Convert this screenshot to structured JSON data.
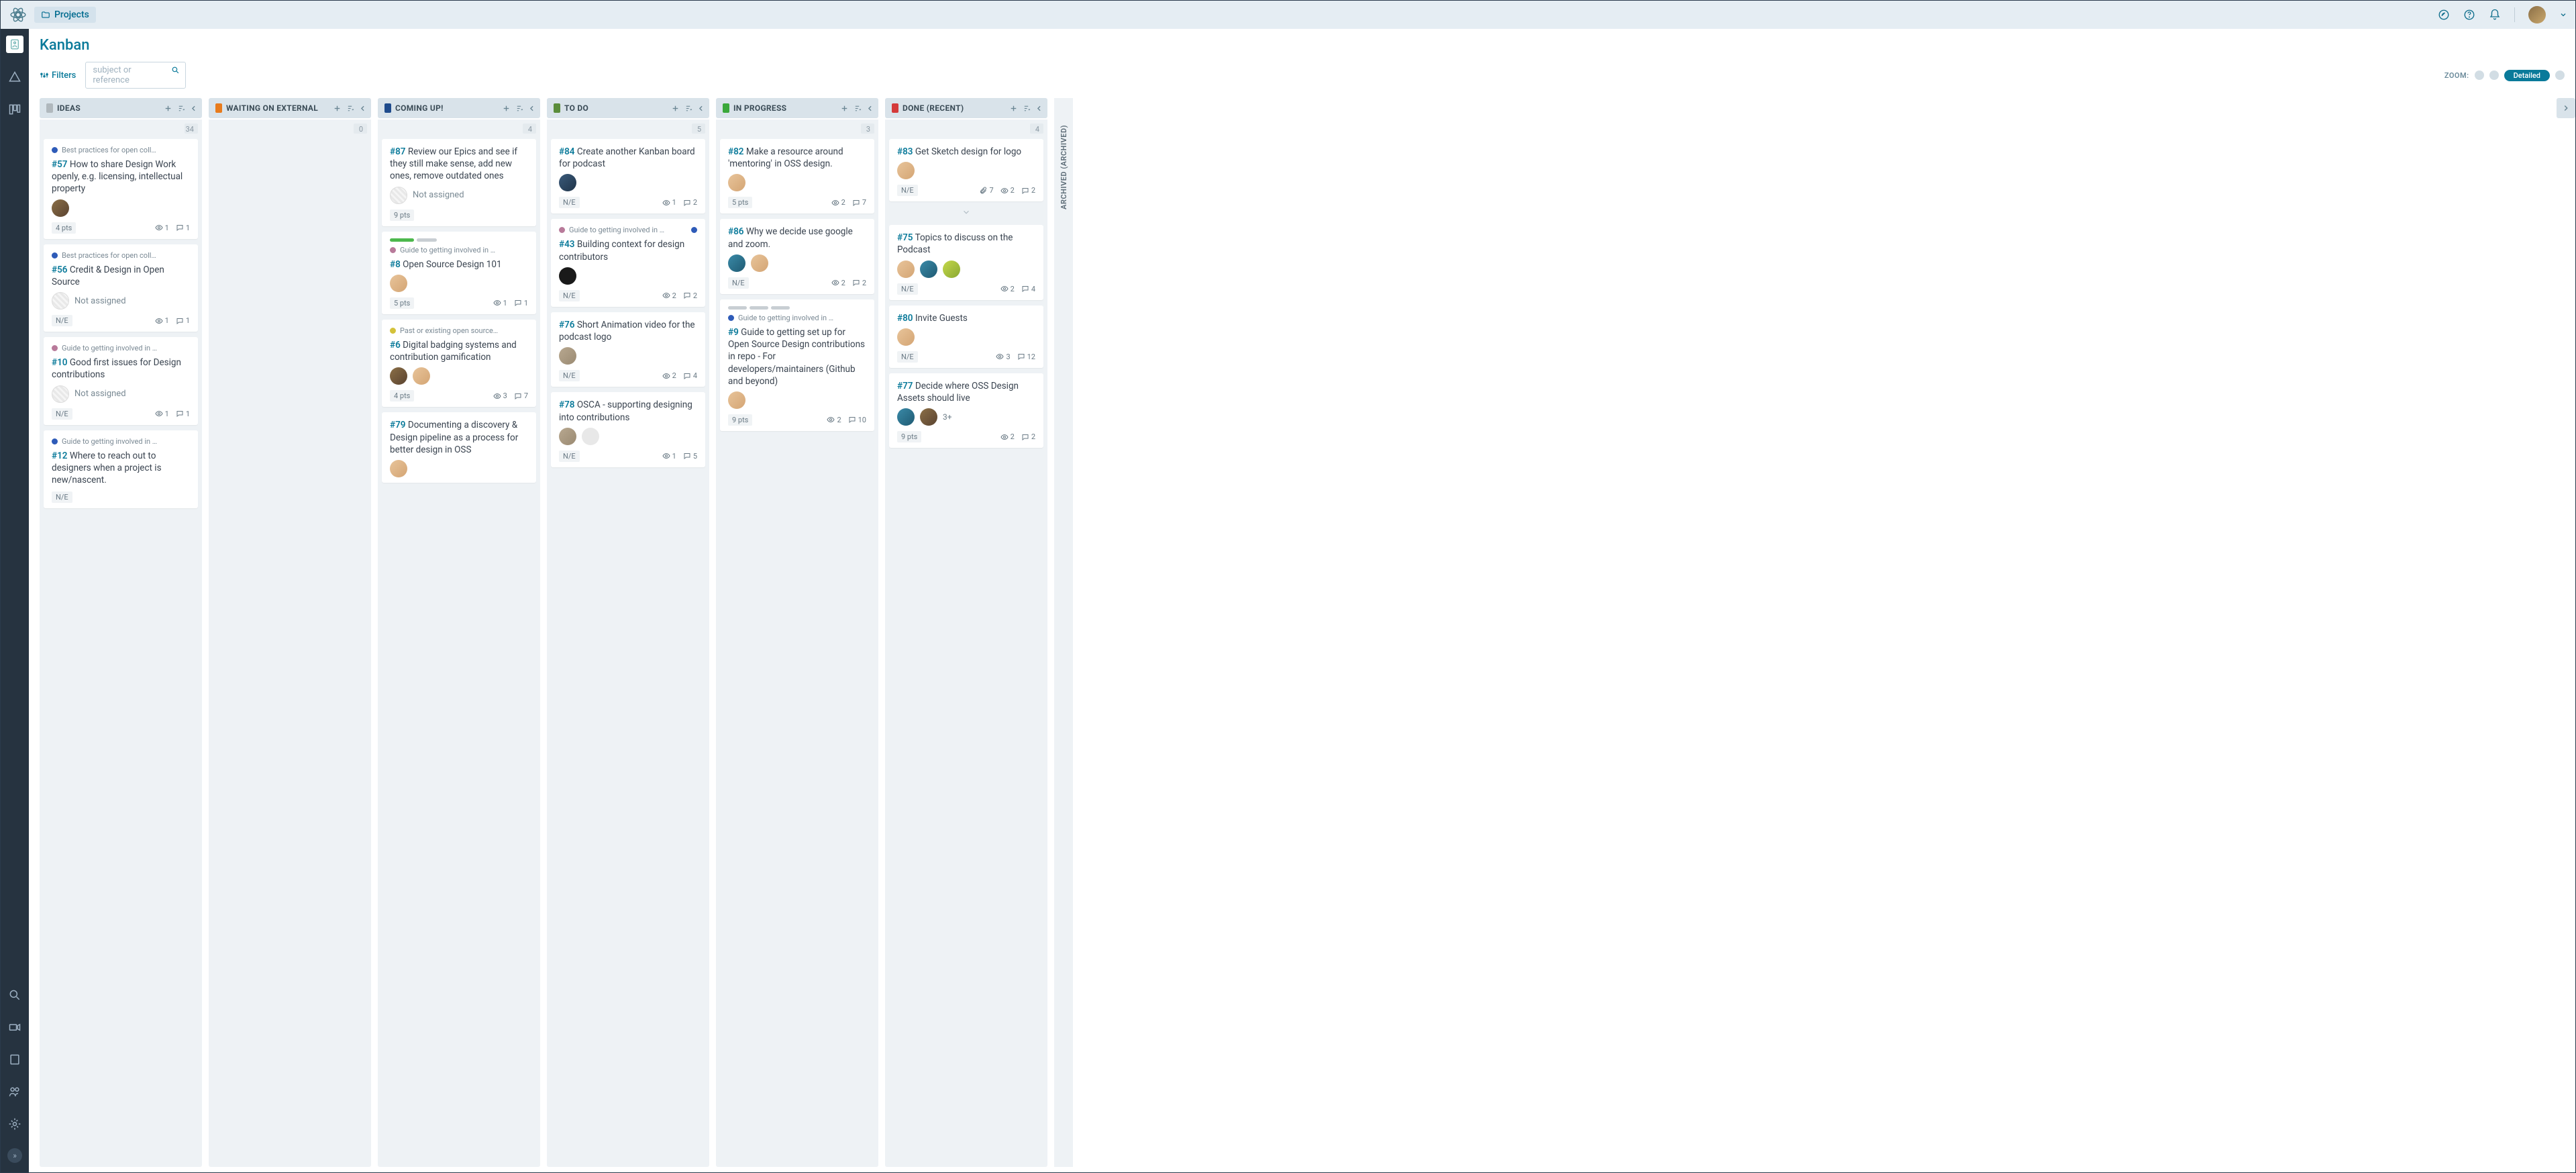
{
  "topbar": {
    "projects_label": "Projects"
  },
  "page": {
    "title": "Kanban",
    "filters_label": "Filters",
    "search_placeholder": "subject or reference"
  },
  "zoom": {
    "label": "ZOOM:",
    "detailed": "Detailed"
  },
  "archived": {
    "label": "ARCHIVED (ARCHIVED)"
  },
  "columns": [
    {
      "name": "IDEAS",
      "color": "#b0b8bd",
      "count": "34",
      "cards": [
        {
          "tags": [
            {
              "color": "#2e5bb8",
              "text": "Best practices for open coll…"
            }
          ],
          "ref": "#57",
          "title": "How to share Design Work openly, e.g. licensing, intellectual property",
          "assignees": [
            {
              "bg": "linear-gradient(135deg,#8b6f47,#5a4330)"
            }
          ],
          "pts": "4 pts",
          "watchers": "1",
          "comments": "1"
        },
        {
          "tags": [
            {
              "color": "#2e5bb8",
              "text": "Best practices for open coll…"
            }
          ],
          "ref": "#56",
          "title": "Credit & Design in Open Source",
          "not_assigned": "Not assigned",
          "pts": "N/E",
          "watchers": "1",
          "comments": "1"
        },
        {
          "tags": [
            {
              "color": "#b87a9a",
              "text": "Guide to getting involved in …"
            }
          ],
          "ref": "#10",
          "title": "Good first issues for Design contributions",
          "not_assigned": "Not assigned",
          "pts": "N/E",
          "watchers": "1",
          "comments": "1"
        },
        {
          "tags": [
            {
              "color": "#2e5bb8",
              "text": "Guide to getting involved in …"
            }
          ],
          "ref": "#12",
          "title": "Where to reach out to designers when a project is new/nascent.",
          "pts": "N/E"
        }
      ]
    },
    {
      "name": "WAITING ON EXTERNAL",
      "color": "#e87b1c",
      "count": "0",
      "cards": []
    },
    {
      "name": "COMING UP!",
      "color": "#1f4b8c",
      "count": "4",
      "cards": [
        {
          "ref": "#87",
          "title": "Review our Epics and see if they still make sense, add new ones, remove outdated ones",
          "not_assigned": "Not assigned",
          "pts": "9 pts"
        },
        {
          "progress": [
            {
              "w": 36,
              "c": "#4db84d"
            },
            {
              "w": 30,
              "c": "#c8ced3"
            }
          ],
          "tags": [
            {
              "color": "#b87a9a",
              "text": "Guide to getting involved in …"
            }
          ],
          "ref": "#8",
          "title": "Open Source Design 101",
          "assignees": [
            {
              "bg": "linear-gradient(135deg,#e8c49a,#d4a574)"
            }
          ],
          "pts": "5 pts",
          "watchers": "1",
          "comments": "1"
        },
        {
          "tags": [
            {
              "color": "#d4c23a",
              "text": "Past or existing open source…"
            }
          ],
          "ref": "#6",
          "title": "Digital badging systems and contribution gamification",
          "assignees": [
            {
              "bg": "linear-gradient(135deg,#8b6f47,#5a4330)"
            },
            {
              "bg": "linear-gradient(135deg,#e8c49a,#d4a574)"
            }
          ],
          "pts": "4 pts",
          "watchers": "3",
          "comments": "7"
        },
        {
          "ref": "#79",
          "title": "Documenting a discovery & Design pipeline as a process for better design in OSS",
          "assignees": [
            {
              "bg": "linear-gradient(135deg,#e8c49a,#d4a574)"
            }
          ]
        }
      ]
    },
    {
      "name": "TO DO",
      "color": "#5a8c3a",
      "count": "5",
      "cards": [
        {
          "ref": "#84",
          "title": "Create another Kanban board for podcast",
          "assignees": [
            {
              "bg": "linear-gradient(135deg,#3a5a7a,#1f3449)"
            }
          ],
          "pts": "N/E",
          "watchers": "1",
          "comments": "2"
        },
        {
          "tags": [
            {
              "color": "#b87a9a",
              "text": "Guide to getting involved in …"
            }
          ],
          "tag_end_dot": "#2e5bb8",
          "ref": "#43",
          "title": "Building context for design contributors",
          "assignees": [
            {
              "bg": "#1a1a1a"
            }
          ],
          "pts": "N/E",
          "watchers": "2",
          "comments": "2"
        },
        {
          "ref": "#76",
          "title": "Short Animation video for the podcast logo",
          "assignees": [
            {
              "bg": "linear-gradient(135deg,#b8a890,#9a8a72)"
            }
          ],
          "pts": "N/E",
          "watchers": "2",
          "comments": "4"
        },
        {
          "ref": "#78",
          "title": "OSCA - supporting designing into contributions",
          "assignees": [
            {
              "bg": "linear-gradient(135deg,#b8a890,#9a8a72)"
            },
            {
              "bg": "#e8e8e8"
            }
          ],
          "pts": "N/E",
          "watchers": "1",
          "comments": "5"
        }
      ]
    },
    {
      "name": "IN PROGRESS",
      "color": "#3aa83a",
      "count": "3",
      "cards": [
        {
          "ref": "#82",
          "title": "Make a resource around 'mentoring' in OSS design.",
          "assignees": [
            {
              "bg": "linear-gradient(135deg,#e8c49a,#d4a574)"
            }
          ],
          "pts": "5 pts",
          "watchers": "2",
          "comments": "7"
        },
        {
          "ref": "#86",
          "title": "Why we decide use google and zoom.",
          "assignees": [
            {
              "bg": "linear-gradient(135deg,#3a8aa8,#1f5a72)"
            },
            {
              "bg": "linear-gradient(135deg,#e8c49a,#d4a574)"
            }
          ],
          "pts": "N/E",
          "watchers": "2",
          "comments": "2"
        },
        {
          "progress": [
            {
              "w": 28,
              "c": "#c8ced3"
            },
            {
              "w": 28,
              "c": "#c8ced3"
            },
            {
              "w": 28,
              "c": "#c8ced3"
            }
          ],
          "tags": [
            {
              "color": "#2e5bb8",
              "text": "Guide to getting involved in …"
            }
          ],
          "ref": "#9",
          "title": "Guide to getting set up for Open Source Design contributions in repo - For developers/maintainers (Github and beyond)",
          "assignees": [
            {
              "bg": "linear-gradient(135deg,#e8c49a,#d4a574)"
            }
          ],
          "pts": "9 pts",
          "watchers": "2",
          "comments": "10"
        }
      ]
    },
    {
      "name": "DONE (RECENT)",
      "color": "#d43a3a",
      "count": "4",
      "cards": [
        {
          "ref": "#83",
          "title": "Get Sketch design for logo",
          "assignees": [
            {
              "bg": "linear-gradient(135deg,#e8c49a,#d4a574)"
            }
          ],
          "pts": "N/E",
          "attachments": "7",
          "watchers": "2",
          "comments": "2",
          "collapse_below": true
        },
        {
          "ref": "#75",
          "title": "Topics to discuss on the Podcast",
          "assignees": [
            {
              "bg": "linear-gradient(135deg,#e8c49a,#d4a574)"
            },
            {
              "bg": "linear-gradient(135deg,#3a8aa8,#1f5a72)"
            },
            {
              "bg": "linear-gradient(135deg,#c4d84a,#8aa832)"
            }
          ],
          "pts": "N/E",
          "watchers": "2",
          "comments": "4"
        },
        {
          "ref": "#80",
          "title": "Invite Guests",
          "assignees": [
            {
              "bg": "linear-gradient(135deg,#e8c49a,#d4a574)"
            }
          ],
          "pts": "N/E",
          "watchers": "3",
          "comments": "12"
        },
        {
          "ref": "#77",
          "title": "Decide where OSS Design Assets should live",
          "assignees": [
            {
              "bg": "linear-gradient(135deg,#3a8aa8,#1f5a72)"
            },
            {
              "bg": "linear-gradient(135deg,#8b6f47,#5a4330)"
            }
          ],
          "extra": "3+",
          "pts": "9 pts",
          "watchers": "2",
          "comments": "2"
        }
      ]
    }
  ]
}
